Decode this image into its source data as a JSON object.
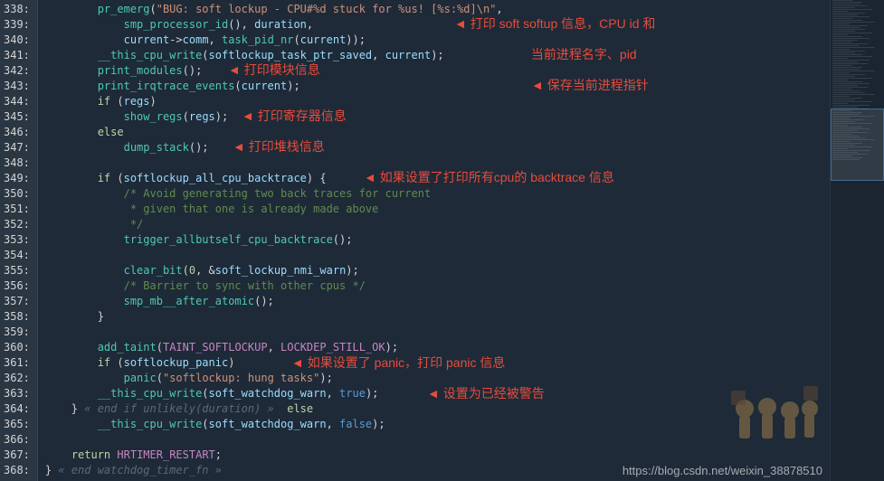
{
  "gutter": [
    "338:",
    "339:",
    "340:",
    "341:",
    "342:",
    "343:",
    "344:",
    "345:",
    "346:",
    "347:",
    "348:",
    "349:",
    "350:",
    "351:",
    "352:",
    "353:",
    "354:",
    "355:",
    "356:",
    "357:",
    "358:",
    "359:",
    "360:",
    "361:",
    "362:",
    "363:",
    "364:",
    "365:",
    "366:",
    "367:",
    "368:"
  ],
  "code": {
    "l338a": "        ",
    "l338_fn": "pr_emerg",
    "l338_str": "\"BUG: soft lockup - CPU#%d stuck for %us! [%s:%d]\\n\"",
    "l339a": "            ",
    "l339_fn": "smp_processor_id",
    "l339_id": "duration",
    "l340a": "            ",
    "l340_id1": "current",
    "l340_id2": "comm",
    "l340_fn": "task_pid_nr",
    "l340_id3": "current",
    "l341a": "        ",
    "l341_fn": "__this_cpu_write",
    "l341_id1": "softlockup_task_ptr_saved",
    "l341_id2": "current",
    "l342a": "        ",
    "l342_fn": "print_modules",
    "l343a": "        ",
    "l343_fn": "print_irqtrace_events",
    "l343_id": "current",
    "l344a": "        ",
    "l344_kw": "if",
    "l344_id": "regs",
    "l345a": "            ",
    "l345_fn": "show_regs",
    "l345_id": "regs",
    "l346a": "        ",
    "l346_kw": "else",
    "l347a": "            ",
    "l347_fn": "dump_stack",
    "l349a": "        ",
    "l349_kw": "if",
    "l349_id": "softlockup_all_cpu_backtrace",
    "l350a": "            ",
    "l350_cmt": "/* Avoid generating two back traces for current",
    "l351a": "             ",
    "l351_cmt": "* given that one is already made above",
    "l352a": "             ",
    "l352_cmt": "*/",
    "l353a": "            ",
    "l353_fn": "trigger_allbutself_cpu_backtrace",
    "l355a": "            ",
    "l355_fn": "clear_bit",
    "l355_num": "0",
    "l355_id": "soft_lockup_nmi_warn",
    "l356a": "            ",
    "l356_cmt": "/* Barrier to sync with other cpus */",
    "l357a": "            ",
    "l357_fn": "smp_mb__after_atomic",
    "l358a": "        }",
    "l360a": "        ",
    "l360_fn": "add_taint",
    "l360_c1": "TAINT_SOFTLOCKUP",
    "l360_c2": "LOCKDEP_STILL_OK",
    "l361a": "        ",
    "l361_kw": "if",
    "l361_id": "softlockup_panic",
    "l362a": "            ",
    "l362_fn": "panic",
    "l362_str": "\"softlockup: hung tasks\"",
    "l363a": "        ",
    "l363_fn": "__this_cpu_write",
    "l363_id": "soft_watchdog_warn",
    "l363_c": "true",
    "l364a": "    } ",
    "l364_hint": "« end if unlikely(duration) »",
    "l364_kw": "  else",
    "l365a": "        ",
    "l365_fn": "__this_cpu_write",
    "l365_id": "soft_watchdog_warn",
    "l365_c": "false",
    "l367a": "    ",
    "l367_kw": "return",
    "l367_c": "HRTIMER_RESTART",
    "l368a": "} ",
    "l368_hint": "« end watchdog_timer_fn »"
  },
  "annotations": {
    "a1": "打印 soft softup 信息，CPU id 和",
    "a2": "当前进程名字、pid",
    "a3": "打印模块信息",
    "a4": "保存当前进程指针",
    "a5": "打印寄存器信息",
    "a6": "打印堆栈信息",
    "a7": "如果设置了打印所有cpu的 backtrace 信息",
    "a8": "如果设置了 panic，打印 panic 信息",
    "a9": "设置为已经被警告"
  },
  "watermark": "https://blog.csdn.net/weixin_38878510"
}
